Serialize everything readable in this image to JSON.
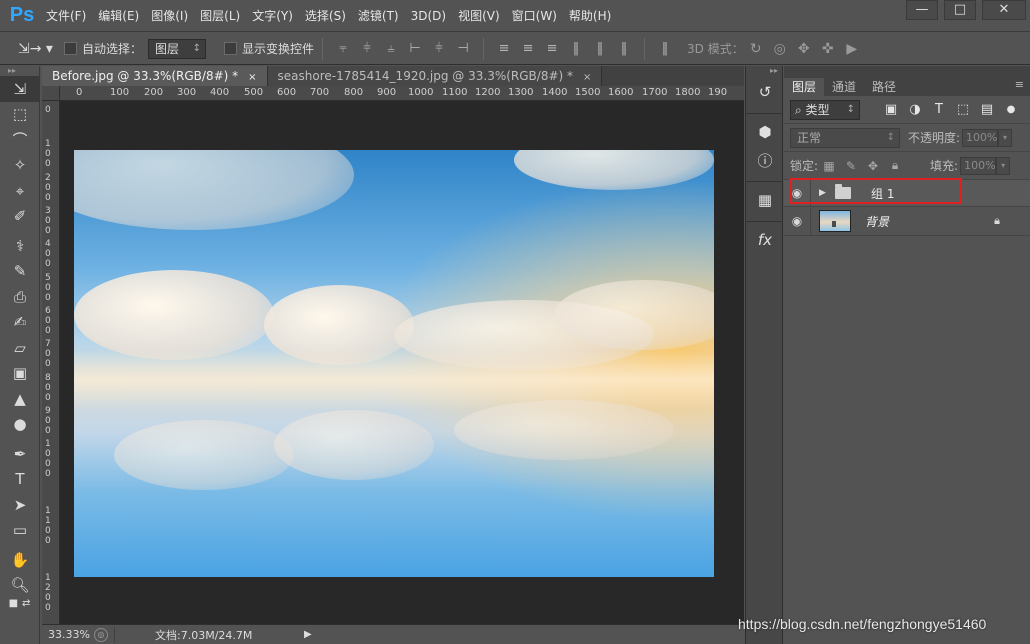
{
  "app": {
    "logo": "Ps"
  },
  "menu": [
    "文件(F)",
    "编辑(E)",
    "图像(I)",
    "图层(L)",
    "文字(Y)",
    "选择(S)",
    "滤镜(T)",
    "3D(D)",
    "视图(V)",
    "窗口(W)",
    "帮助(H)"
  ],
  "window_controls": {
    "minimize": "—",
    "maximize": "□",
    "close": "✕"
  },
  "options": {
    "auto_select_label": "自动选择：",
    "auto_select_value": "图层",
    "show_transform_label": "显示变换控件",
    "mode3d_label": "3D 模式："
  },
  "tabs": [
    {
      "title": "Before.jpg @ 33.3%(RGB/8#) *",
      "close": "×",
      "active": true
    },
    {
      "title": "seashore-1785414_1920.jpg @ 33.3%(RGB/8#) *",
      "close": "×",
      "active": false
    }
  ],
  "ruler_top": [
    "0",
    "100",
    "200",
    "300",
    "400",
    "500",
    "600",
    "700",
    "800",
    "900",
    "1000",
    "1100",
    "1200",
    "1300",
    "1400",
    "1500",
    "1600",
    "1700",
    "1800",
    "190"
  ],
  "ruler_left": [
    "0",
    "1",
    "0",
    "0",
    "2",
    "0",
    "0",
    "3",
    "0",
    "0",
    "4",
    "0",
    "0",
    "5",
    "0",
    "0",
    "6",
    "0",
    "0",
    "7",
    "0",
    "0",
    "8",
    "0",
    "0",
    "9",
    "0",
    "0",
    "1",
    "0",
    "0",
    "0",
    "1",
    "1",
    "0",
    "0",
    "1",
    "2",
    "0",
    "0"
  ],
  "status": {
    "zoom": "33.33%",
    "doc": "文档:7.03M/24.7M"
  },
  "layers_panel": {
    "tabs": [
      "图层",
      "通道",
      "路径"
    ],
    "filter_label": "类型",
    "blend_mode": "正常",
    "opacity_label": "不透明度:",
    "opacity_value": "100%",
    "lock_label": "锁定:",
    "fill_label": "填充:",
    "fill_value": "100%",
    "layers": [
      {
        "name": "组 1",
        "type": "group",
        "visible": true
      },
      {
        "name": "背景",
        "type": "image",
        "visible": true,
        "locked": true
      }
    ]
  },
  "watermark": "https://blog.csdn.net/fengzhongye51460",
  "colors": {
    "highlight": "#e02020",
    "ps_blue": "#31a8ff",
    "panel_bg": "#535353",
    "canvas_bg": "#282828"
  }
}
